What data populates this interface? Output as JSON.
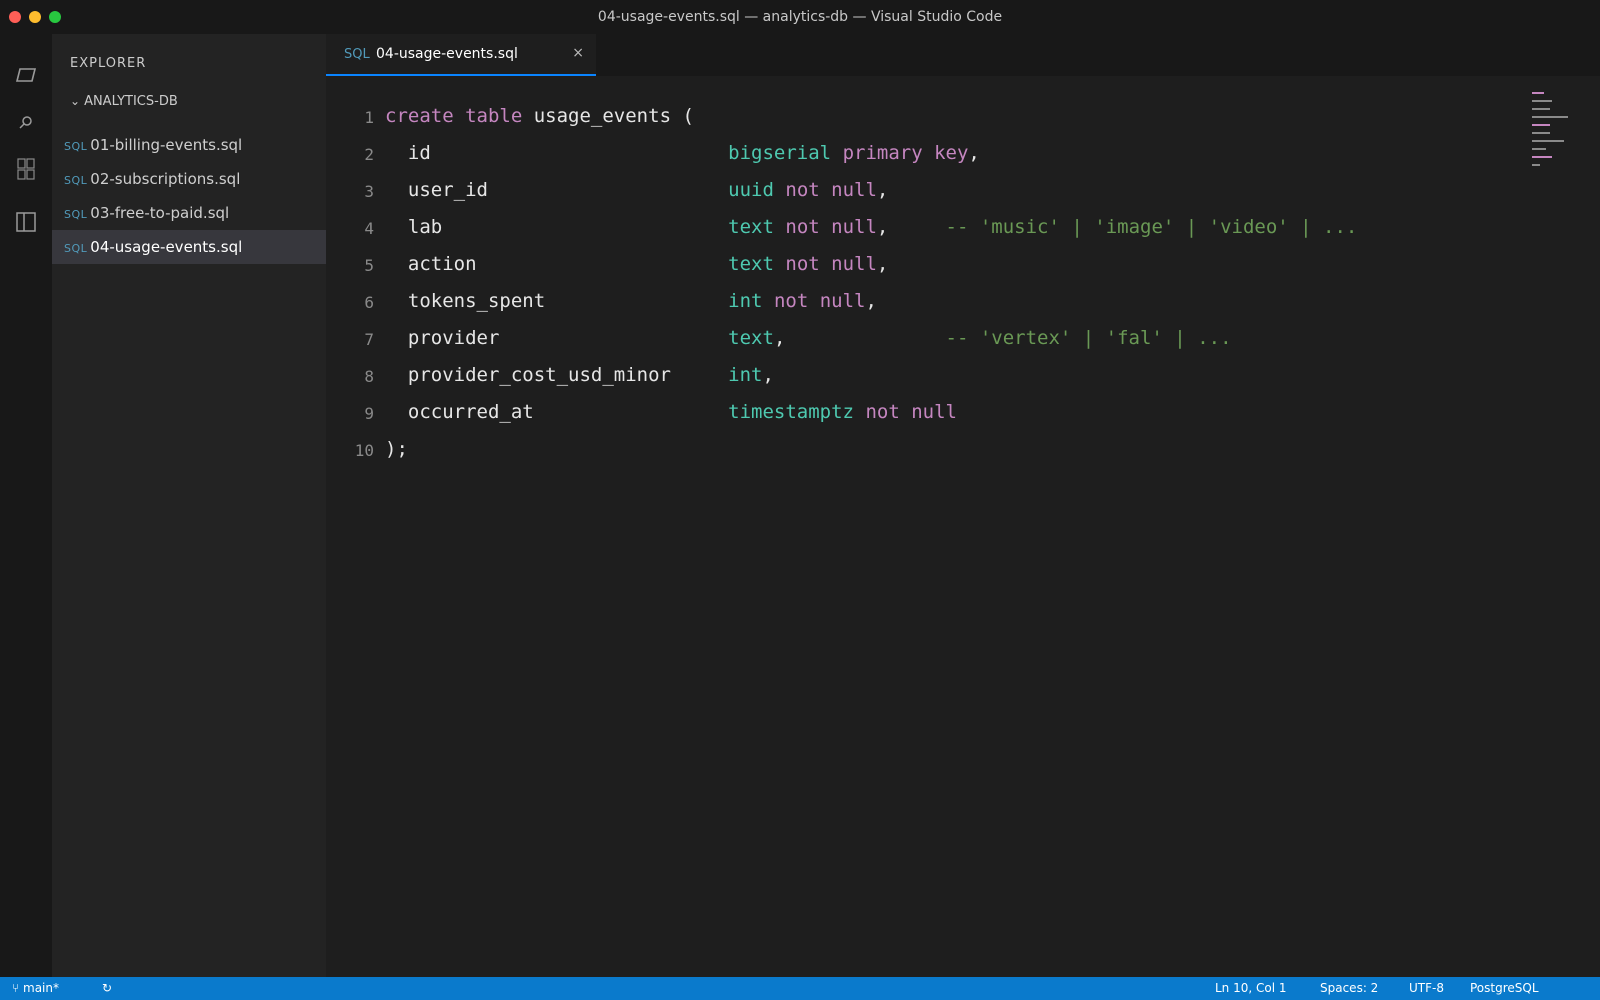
{
  "window": {
    "title": "04-usage-events.sql — analytics-db — Visual Studio Code"
  },
  "activity_bar": {
    "icons": [
      "explorer-icon",
      "search-icon",
      "extensions-icon",
      "split-panel-icon"
    ]
  },
  "sidebar": {
    "heading": "EXPLORER",
    "folder": "ANALYTICS-DB",
    "file_tag": "SQL",
    "items": [
      {
        "label": "01-billing-events.sql"
      },
      {
        "label": "02-subscriptions.sql"
      },
      {
        "label": "03-free-to-paid.sql"
      },
      {
        "label": "04-usage-events.sql",
        "active": true
      }
    ]
  },
  "tab": {
    "tag": "SQL",
    "name": "04-usage-events.sql",
    "close": "×"
  },
  "editor": {
    "line_numbers": [
      "1",
      "2",
      "3",
      "4",
      "5",
      "6",
      "7",
      "8",
      "9",
      "10"
    ],
    "lines": [
      [
        {
          "t": "create",
          "c": "kw"
        },
        {
          "t": " ",
          "c": "plain"
        },
        {
          "t": "table",
          "c": "kw"
        },
        {
          "t": " usage_events (",
          "c": "plain"
        }
      ],
      [
        {
          "t": "  id                          ",
          "c": "plain"
        },
        {
          "t": "bigserial",
          "c": "type"
        },
        {
          "t": " ",
          "c": "plain"
        },
        {
          "t": "primary key",
          "c": "kw"
        },
        {
          "t": ",",
          "c": "punct"
        }
      ],
      [
        {
          "t": "  user_id                     ",
          "c": "plain"
        },
        {
          "t": "uuid",
          "c": "type"
        },
        {
          "t": " ",
          "c": "plain"
        },
        {
          "t": "not null",
          "c": "kw"
        },
        {
          "t": ",",
          "c": "punct"
        }
      ],
      [
        {
          "t": "  lab                         ",
          "c": "plain"
        },
        {
          "t": "text",
          "c": "type"
        },
        {
          "t": " ",
          "c": "plain"
        },
        {
          "t": "not null",
          "c": "kw"
        },
        {
          "t": ",     ",
          "c": "punct"
        },
        {
          "t": "-- 'music' | 'image' | 'video' | ...",
          "c": "cm"
        }
      ],
      [
        {
          "t": "  action                      ",
          "c": "plain"
        },
        {
          "t": "text",
          "c": "type"
        },
        {
          "t": " ",
          "c": "plain"
        },
        {
          "t": "not null",
          "c": "kw"
        },
        {
          "t": ",",
          "c": "punct"
        }
      ],
      [
        {
          "t": "  tokens_spent                ",
          "c": "plain"
        },
        {
          "t": "int",
          "c": "type"
        },
        {
          "t": " ",
          "c": "plain"
        },
        {
          "t": "not null",
          "c": "kw"
        },
        {
          "t": ",",
          "c": "punct"
        }
      ],
      [
        {
          "t": "  provider                    ",
          "c": "plain"
        },
        {
          "t": "text",
          "c": "type"
        },
        {
          "t": ",              ",
          "c": "punct"
        },
        {
          "t": "-- 'vertex' | 'fal' | ...",
          "c": "cm"
        }
      ],
      [
        {
          "t": "  provider_cost_usd_minor     ",
          "c": "plain"
        },
        {
          "t": "int",
          "c": "type"
        },
        {
          "t": ",",
          "c": "punct"
        }
      ],
      [
        {
          "t": "  occurred_at                 ",
          "c": "plain"
        },
        {
          "t": "timestamptz",
          "c": "type"
        },
        {
          "t": " ",
          "c": "plain"
        },
        {
          "t": "not null",
          "c": "kw"
        }
      ],
      [
        {
          "t": ");",
          "c": "plain"
        }
      ]
    ]
  },
  "status_bar": {
    "branch": "main*",
    "sync": "↻",
    "position": "Ln 10, Col 1",
    "spaces": "Spaces: 2",
    "encoding": "UTF-8",
    "language": "PostgreSQL"
  },
  "colors": {
    "keyword": "#c586c0",
    "type": "#4ec9b0",
    "comment": "#6a9955",
    "accent": "#0a7acc"
  }
}
